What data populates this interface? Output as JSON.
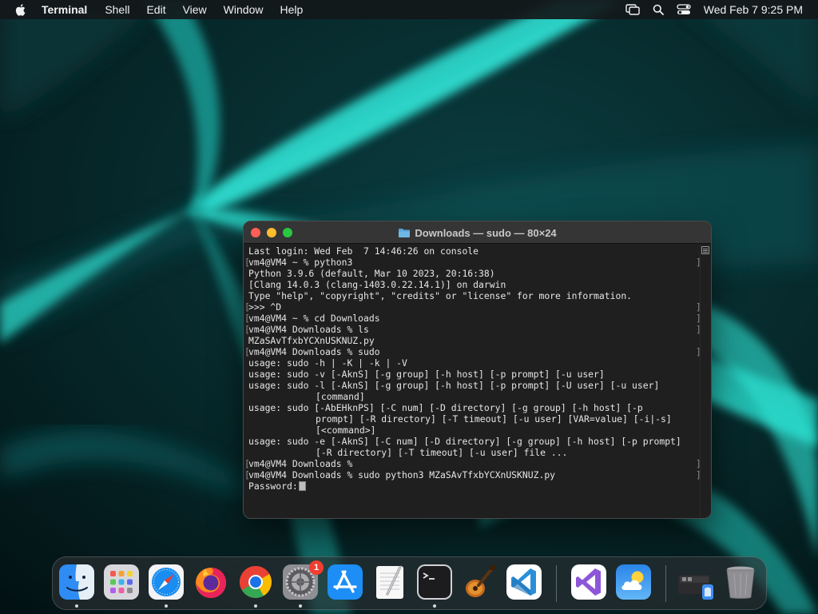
{
  "menubar": {
    "app_name": "Terminal",
    "items": [
      "Shell",
      "Edit",
      "View",
      "Window",
      "Help"
    ],
    "clock": "Wed Feb 7  9:25 PM",
    "icons": [
      "apple-icon",
      "screen-mirroring-icon",
      "spotlight-search-icon",
      "control-center-icon"
    ]
  },
  "terminal": {
    "title": "Downloads — sudo — 80×24",
    "lines": [
      {
        "text": "Last login: Wed Feb  7 14:46:26 on console",
        "marked": false
      },
      {
        "text": "vm4@VM4 ~ % python3",
        "marked": true
      },
      {
        "text": "Python 3.9.6 (default, Mar 10 2023, 20:16:38)",
        "marked": false
      },
      {
        "text": "[Clang 14.0.3 (clang-1403.0.22.14.1)] on darwin",
        "marked": false
      },
      {
        "text": "Type \"help\", \"copyright\", \"credits\" or \"license\" for more information.",
        "marked": false
      },
      {
        "text": ">>> ^D",
        "marked": true
      },
      {
        "text": "vm4@VM4 ~ % cd Downloads",
        "marked": true
      },
      {
        "text": "vm4@VM4 Downloads % ls",
        "marked": true
      },
      {
        "text": "MZaSAvTfxbYCXnUSKNUZ.py",
        "marked": false
      },
      {
        "text": "vm4@VM4 Downloads % sudo",
        "marked": true
      },
      {
        "text": "usage: sudo -h | -K | -k | -V",
        "marked": false
      },
      {
        "text": "usage: sudo -v [-AknS] [-g group] [-h host] [-p prompt] [-u user]",
        "marked": false
      },
      {
        "text": "usage: sudo -l [-AknS] [-g group] [-h host] [-p prompt] [-U user] [-u user]",
        "marked": false
      },
      {
        "text": "[command]",
        "marked": false,
        "cont": true
      },
      {
        "text": "usage: sudo [-AbEHknPS] [-C num] [-D directory] [-g group] [-h host] [-p",
        "marked": false
      },
      {
        "text": "prompt] [-R directory] [-T timeout] [-u user] [VAR=value] [-i|-s]",
        "marked": false,
        "cont": true
      },
      {
        "text": "[<command>]",
        "marked": false,
        "cont": true
      },
      {
        "text": "usage: sudo -e [-AknS] [-C num] [-D directory] [-g group] [-h host] [-p prompt]",
        "marked": false
      },
      {
        "text": "[-R directory] [-T timeout] [-u user] file ...",
        "marked": false,
        "cont": true
      },
      {
        "text": "vm4@VM4 Downloads %",
        "marked": true
      },
      {
        "text": "vm4@VM4 Downloads % sudo python3 MZaSAvTfxbYCXnUSKNUZ.py",
        "marked": true
      },
      {
        "text": "Password:",
        "marked": false,
        "cursor": true
      }
    ]
  },
  "dock": {
    "apps": [
      {
        "name": "finder",
        "running": true
      },
      {
        "name": "launchpad",
        "running": false
      },
      {
        "name": "safari",
        "running": true
      },
      {
        "name": "firefox",
        "running": false
      },
      {
        "name": "chrome",
        "running": true
      },
      {
        "name": "system-settings",
        "running": true,
        "badge": "1"
      },
      {
        "name": "app-store",
        "running": false
      },
      {
        "name": "textedit",
        "running": false
      },
      {
        "name": "terminal",
        "running": true
      },
      {
        "name": "garageband",
        "running": false
      },
      {
        "name": "vscode",
        "running": false
      },
      {
        "name": "visual-studio",
        "running": false
      },
      {
        "name": "weather",
        "running": false
      },
      {
        "name": "downloads-stack",
        "running": false
      },
      {
        "name": "trash",
        "running": false
      }
    ]
  },
  "colors": {
    "terminal_bg": "#1f1f1f",
    "terminal_text": "#e6e6e6",
    "titlebar": "#353535",
    "close": "#ff5f57",
    "minimize": "#febc2e",
    "zoom": "#28c840",
    "wallpaper_glow": "#2ee6d6"
  }
}
